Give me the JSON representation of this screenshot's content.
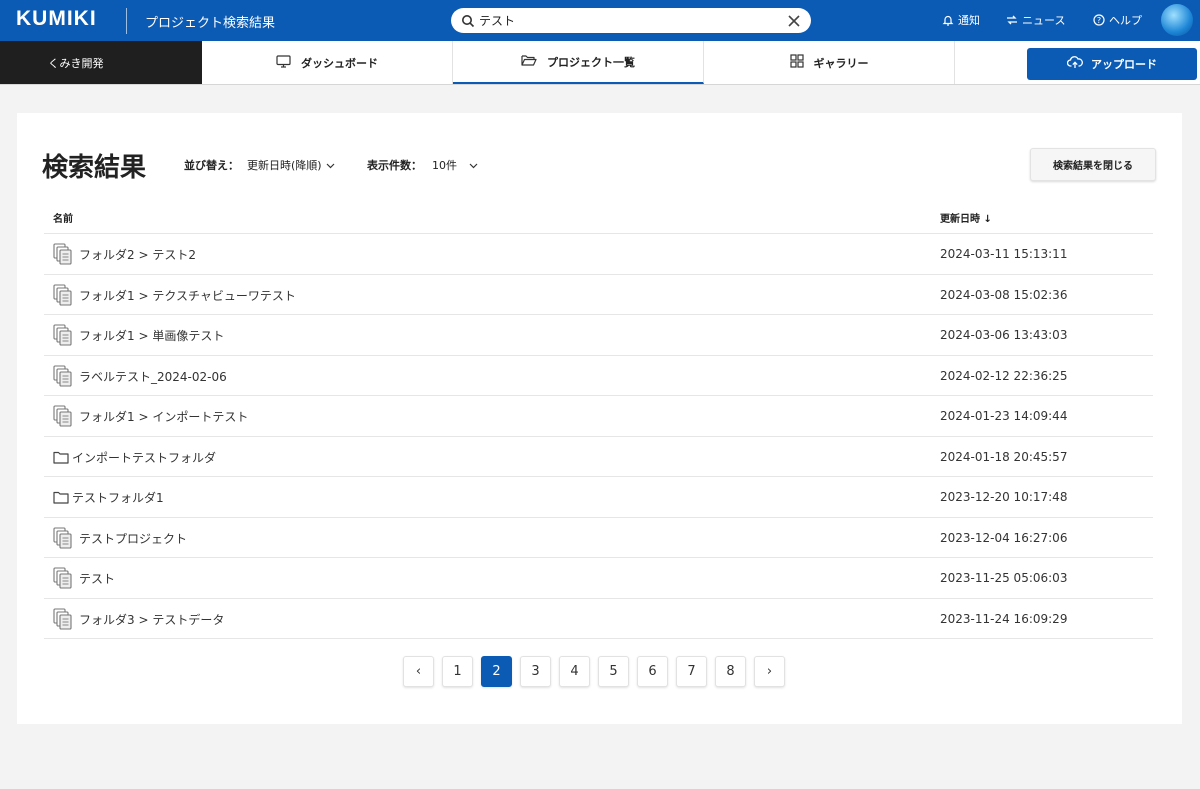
{
  "header": {
    "logo": "KUMIKI",
    "title": "プロジェクト検索結果",
    "search_value": "テスト",
    "nav": [
      {
        "label": "通知",
        "icon": "bell-icon"
      },
      {
        "label": "ニュース",
        "icon": "news-icon"
      },
      {
        "label": "ヘルプ",
        "icon": "help-icon"
      }
    ]
  },
  "tabbar": {
    "org": "くみき開発",
    "tabs": [
      {
        "label": "ダッシュボード",
        "icon": "monitor-icon"
      },
      {
        "label": "プロジェクト一覧",
        "icon": "folder-open-icon",
        "active": true
      },
      {
        "label": "ギャラリー",
        "icon": "grid-icon"
      }
    ],
    "upload": "アップロード"
  },
  "main": {
    "heading": "検索結果",
    "sort_label": "並び替え：",
    "sort_value": "更新日時(降順)",
    "count_label": "表示件数：",
    "count_value": "10件",
    "close_button": "検索結果を閉じる",
    "columns": {
      "name": "名前",
      "date": "更新日時 ↓"
    },
    "rows": [
      {
        "type": "project",
        "name": "フォルダ2 > テスト2",
        "date": "2024-03-11 15:13:11"
      },
      {
        "type": "project",
        "name": "フォルダ1 > テクスチャビューワテスト",
        "date": "2024-03-08 15:02:36"
      },
      {
        "type": "project",
        "name": "フォルダ1 > 単画像テスト",
        "date": "2024-03-06 13:43:03"
      },
      {
        "type": "project",
        "name": "ラベルテスト_2024-02-06",
        "date": "2024-02-12 22:36:25"
      },
      {
        "type": "project",
        "name": "フォルダ1 > インポートテスト",
        "date": "2024-01-23 14:09:44"
      },
      {
        "type": "folder",
        "name": "インポートテストフォルダ",
        "date": "2024-01-18 20:45:57"
      },
      {
        "type": "folder",
        "name": "テストフォルダ1",
        "date": "2023-12-20 10:17:48"
      },
      {
        "type": "project",
        "name": "テストプロジェクト",
        "date": "2023-12-04 16:27:06"
      },
      {
        "type": "project",
        "name": "テスト",
        "date": "2023-11-25 05:06:03"
      },
      {
        "type": "project",
        "name": "フォルダ3 > テストデータ",
        "date": "2023-11-24 16:09:29"
      }
    ],
    "pagination": {
      "prev": "‹",
      "next": "›",
      "pages": [
        "1",
        "2",
        "3",
        "4",
        "5",
        "6",
        "7",
        "8"
      ],
      "current": "2"
    }
  },
  "colors": {
    "brand": "#0b5bb5",
    "org_bg": "#1f1f1f"
  }
}
